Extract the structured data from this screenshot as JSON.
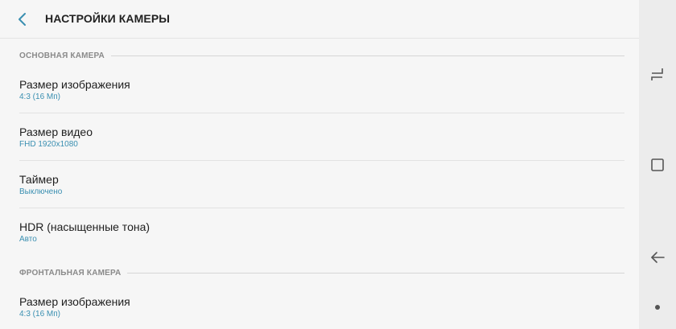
{
  "header": {
    "title": "НАСТРОЙКИ КАМЕРЫ",
    "back_icon": "chevron-left-icon"
  },
  "sections": [
    {
      "label": "ОСНОВНАЯ КАМЕРА",
      "items": [
        {
          "title": "Размер изображения",
          "value": "4:3 (16 Мп)"
        },
        {
          "title": "Размер видео",
          "value": "FHD 1920x1080"
        },
        {
          "title": "Таймер",
          "value": "Выключено"
        },
        {
          "title": "HDR (насыщенные тона)",
          "value": "Авто"
        }
      ]
    },
    {
      "label": "ФРОНТАЛЬНАЯ КАМЕРА",
      "items": [
        {
          "title": "Размер изображения",
          "value": "4:3 (16 Мп)"
        }
      ]
    }
  ],
  "navbar": {
    "buttons": [
      "recents-icon",
      "home-icon",
      "back-icon"
    ],
    "indicator": "dot-icon"
  },
  "colors": {
    "accent": "#3a8fb1",
    "background": "#f6f6f6",
    "navbar": "#ececec"
  }
}
